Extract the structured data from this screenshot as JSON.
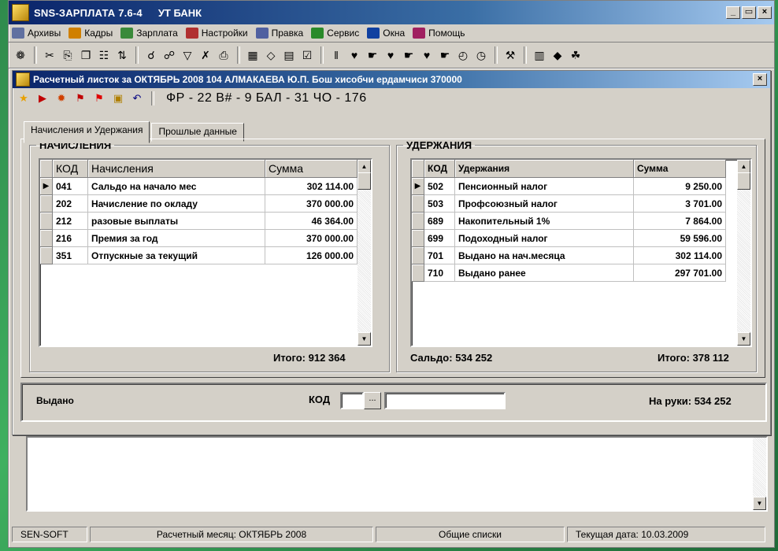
{
  "app": {
    "title": "SNS-ЗАРПЛАТА 7.6-4",
    "subtitle": "УТ БАНК",
    "window_buttons": [
      "_",
      "▭",
      "×"
    ]
  },
  "menu": [
    {
      "label": "Архивы",
      "icon": "archive-icon"
    },
    {
      "label": "Кадры",
      "icon": "person-icon"
    },
    {
      "label": "Зарплата",
      "icon": "money-icon"
    },
    {
      "label": "Настройки",
      "icon": "settings-icon"
    },
    {
      "label": "Правка",
      "icon": "edit-icon"
    },
    {
      "label": "Сервис",
      "icon": "service-icon"
    },
    {
      "label": "Окна",
      "icon": "windows-icon"
    },
    {
      "label": "Помощь",
      "icon": "help-icon"
    }
  ],
  "toolbar": [
    {
      "icon": "globe-icon",
      "glyph": "❁"
    },
    {
      "sep": true
    },
    {
      "icon": "cut-icon",
      "glyph": "✂"
    },
    {
      "icon": "copy-icon",
      "glyph": "⎘"
    },
    {
      "icon": "preview-icon",
      "glyph": "❐"
    },
    {
      "icon": "paste-icon",
      "glyph": "☷"
    },
    {
      "icon": "sort-icon",
      "glyph": "⇅"
    },
    {
      "sep": true
    },
    {
      "icon": "find-icon",
      "glyph": "☌"
    },
    {
      "icon": "find-next-icon",
      "glyph": "☍"
    },
    {
      "icon": "filter-icon",
      "glyph": "▽"
    },
    {
      "icon": "clear-filter-icon",
      "glyph": "✗"
    },
    {
      "icon": "print-icon",
      "glyph": "⎙"
    },
    {
      "sep": true
    },
    {
      "icon": "calculator-icon",
      "glyph": "▦"
    },
    {
      "icon": "eraser-icon",
      "glyph": "◇"
    },
    {
      "icon": "calendar-icon",
      "glyph": "▤"
    },
    {
      "icon": "report-icon",
      "glyph": "☑"
    },
    {
      "sep": true
    },
    {
      "icon": "split-icon",
      "glyph": "‖"
    },
    {
      "icon": "heart-icon",
      "glyph": "♥"
    },
    {
      "icon": "hand-icon",
      "glyph": "☛"
    },
    {
      "icon": "heart2-icon",
      "glyph": "♥"
    },
    {
      "icon": "hand2-icon",
      "glyph": "☛"
    },
    {
      "icon": "heart3-icon",
      "glyph": "♥"
    },
    {
      "icon": "hand3-icon",
      "glyph": "☛"
    },
    {
      "icon": "clock-icon",
      "glyph": "◴"
    },
    {
      "icon": "clock2-icon",
      "glyph": "◷"
    },
    {
      "sep": true
    },
    {
      "icon": "wrench-icon",
      "glyph": "⚒"
    },
    {
      "sep": true
    },
    {
      "icon": "table-icon",
      "glyph": "▥"
    },
    {
      "icon": "book-icon",
      "glyph": "◆"
    },
    {
      "icon": "tree-icon",
      "glyph": "☘"
    }
  ],
  "colors": {
    "title_bar": "#0a246a",
    "window_bg": "#d4d0c8",
    "desktop": "#3fb060"
  },
  "doc": {
    "title": "Расчетный листок за ОКТЯБРЬ 2008  104  АЛМАКАЕВА Ю.П.  Бош хисобчи ердамчиси  370000",
    "close": "×",
    "toolbar_icons": [
      {
        "icon": "person-run-icon",
        "glyph": "★",
        "color": "#e8a000"
      },
      {
        "icon": "arrow-right-icon",
        "glyph": "▶",
        "color": "#c00000"
      },
      {
        "icon": "sun-icon",
        "glyph": "✹",
        "color": "#d04000"
      },
      {
        "icon": "flag-icon",
        "glyph": "⚑",
        "color": "#c00000"
      },
      {
        "icon": "flag2-icon",
        "glyph": "⚑",
        "color": "#e00000"
      },
      {
        "icon": "bulb-icon",
        "glyph": "▣",
        "color": "#b08000"
      },
      {
        "icon": "undo-icon",
        "glyph": "↶",
        "color": "#000080"
      }
    ],
    "stats": "ФР - 22  В# - 9  БАЛ - 31  ЧО - 176",
    "tabs": [
      "Начисления и Удержания",
      "Прошлые данные"
    ],
    "accruals": {
      "legend": "НАЧИСЛЕНИЯ",
      "headers": [
        "КОД",
        "Начисления",
        "Сумма"
      ],
      "rows": [
        {
          "code": "041",
          "name": "Сальдо на начало мес",
          "sum": "302 114.00",
          "current": true
        },
        {
          "code": "202",
          "name": "Начисление по окладу",
          "sum": "370 000.00"
        },
        {
          "code": "212",
          "name": "разовые выплаты",
          "sum": "46 364.00"
        },
        {
          "code": "216",
          "name": "Премия за год",
          "sum": "370 000.00"
        },
        {
          "code": "351",
          "name": "Отпускные за текущий",
          "sum": "126 000.00"
        }
      ],
      "total_label": "Итого:",
      "total": "912 364"
    },
    "deductions": {
      "legend": "УДЕРЖАНИЯ",
      "headers": [
        "КОД",
        "Удержания",
        "Сумма"
      ],
      "rows": [
        {
          "code": "502",
          "name": "Пенсионный налог",
          "sum": "9 250.00",
          "current": true
        },
        {
          "code": "503",
          "name": "Профсоюзный налог",
          "sum": "3 701.00"
        },
        {
          "code": "689",
          "name": "Накопительный 1%",
          "sum": "7 864.00"
        },
        {
          "code": "699",
          "name": "Подоходный налог",
          "sum": "59 596.00"
        },
        {
          "code": "701",
          "name": "Выдано на нач.месяца",
          "sum": "302 114.00"
        },
        {
          "code": "710",
          "name": "Выдано ранее",
          "sum": "297 701.00"
        }
      ],
      "saldo_label": "Сальдо:",
      "saldo": "534 252",
      "total_label": "Итого:",
      "total": "378 112"
    },
    "issued": {
      "label": "Выдано",
      "code_label": "КОД",
      "code_value": "",
      "browse": "...",
      "name_value": "",
      "hand_label": "На руки:",
      "hand_value": "534 252"
    }
  },
  "status": [
    "SEN-SOFT",
    "Расчетный месяц:  ОКТЯБРЬ 2008",
    "Общие списки",
    "Текущая дата:  10.03.2009"
  ]
}
